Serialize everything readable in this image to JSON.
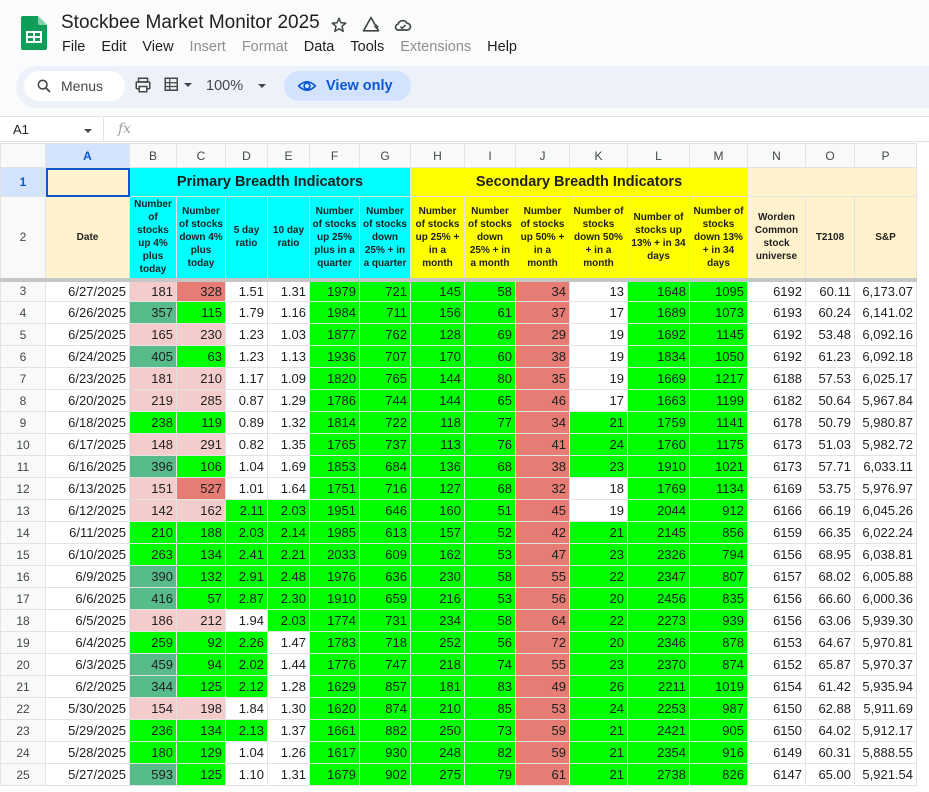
{
  "app": {
    "title": "Stockbee Market Monitor 2025",
    "menu": [
      {
        "label": "File",
        "enabled": true
      },
      {
        "label": "Edit",
        "enabled": true
      },
      {
        "label": "View",
        "enabled": true
      },
      {
        "label": "Insert",
        "enabled": false
      },
      {
        "label": "Format",
        "enabled": false
      },
      {
        "label": "Data",
        "enabled": true
      },
      {
        "label": "Tools",
        "enabled": true
      },
      {
        "label": "Extensions",
        "enabled": false
      },
      {
        "label": "Help",
        "enabled": true
      }
    ]
  },
  "toolbar": {
    "search_label": "Menus",
    "zoom": "100%",
    "view_only_label": "View only"
  },
  "formula_bar": {
    "cell_ref": "A1",
    "fx_label": "fx",
    "value": ""
  },
  "colors": {
    "cyan": "#00ffff",
    "yellow": "#ffff00",
    "cream": "#fff2cc",
    "green": "#00ff00",
    "dark_green": "#57bb8a",
    "red": "#e67c73",
    "pink": "#f4cccc",
    "white": "#ffffff"
  },
  "sheet": {
    "columns": [
      "A",
      "B",
      "C",
      "D",
      "E",
      "F",
      "G",
      "H",
      "I",
      "J",
      "K",
      "L",
      "M",
      "N",
      "O",
      "P"
    ],
    "selected_column": "A",
    "selected_row": "1",
    "group_headers": {
      "primary": "Primary Breadth Indicators",
      "secondary": "Secondary Breadth Indicators"
    },
    "headers": [
      "Date",
      "Number of stocks up 4% plus today",
      "Number of stocks down 4% plus today",
      "5 day ratio",
      "10 day ratio",
      "Number of stocks up 25% plus in a quarter",
      "Number of stocks down 25% + in a quarter",
      "Number of stocks up 25% + in a month",
      "Number of stocks down 25% + in a month",
      "Number of stocks up 50% + in a month",
      "Number of stocks down 50% + in a month",
      "Number of stocks up 13% + in 34 days",
      "Number of stocks down 13% + in 34 days",
      "Worden Common stock universe",
      "T2108",
      "S&P"
    ],
    "rows": [
      {
        "n": "3",
        "cells": [
          "6/27/2025",
          "181",
          "328",
          "1.51",
          "1.31",
          "1979",
          "721",
          "145",
          "58",
          "34",
          "13",
          "1648",
          "1095",
          "6192",
          "60.11",
          "6,173.07"
        ],
        "fills": [
          "",
          "pink",
          "red",
          "",
          "",
          "green",
          "green",
          "green",
          "green",
          "red",
          "white",
          "green",
          "green",
          "",
          "",
          ""
        ]
      },
      {
        "n": "4",
        "cells": [
          "6/26/2025",
          "357",
          "115",
          "1.79",
          "1.16",
          "1984",
          "711",
          "156",
          "61",
          "37",
          "17",
          "1689",
          "1073",
          "6193",
          "60.24",
          "6,141.02"
        ],
        "fills": [
          "",
          "dgreen",
          "green",
          "",
          "",
          "green",
          "green",
          "green",
          "green",
          "red",
          "white",
          "green",
          "green",
          "",
          "",
          ""
        ]
      },
      {
        "n": "5",
        "cells": [
          "6/25/2025",
          "165",
          "230",
          "1.23",
          "1.03",
          "1877",
          "762",
          "128",
          "69",
          "29",
          "19",
          "1692",
          "1145",
          "6192",
          "53.48",
          "6,092.16"
        ],
        "fills": [
          "",
          "pink",
          "pink",
          "",
          "",
          "green",
          "green",
          "green",
          "green",
          "red",
          "white",
          "green",
          "green",
          "",
          "",
          ""
        ]
      },
      {
        "n": "6",
        "cells": [
          "6/24/2025",
          "405",
          "63",
          "1.23",
          "1.13",
          "1936",
          "707",
          "170",
          "60",
          "38",
          "19",
          "1834",
          "1050",
          "6192",
          "61.23",
          "6,092.18"
        ],
        "fills": [
          "",
          "dgreen",
          "green",
          "",
          "",
          "green",
          "green",
          "green",
          "green",
          "red",
          "white",
          "green",
          "green",
          "",
          "",
          ""
        ]
      },
      {
        "n": "7",
        "cells": [
          "6/23/2025",
          "181",
          "210",
          "1.17",
          "1.09",
          "1820",
          "765",
          "144",
          "80",
          "35",
          "19",
          "1669",
          "1217",
          "6188",
          "57.53",
          "6,025.17"
        ],
        "fills": [
          "",
          "pink",
          "pink",
          "",
          "",
          "green",
          "green",
          "green",
          "green",
          "red",
          "white",
          "green",
          "green",
          "",
          "",
          ""
        ]
      },
      {
        "n": "8",
        "cells": [
          "6/20/2025",
          "219",
          "285",
          "0.87",
          "1.29",
          "1786",
          "744",
          "144",
          "65",
          "46",
          "17",
          "1663",
          "1199",
          "6182",
          "50.64",
          "5,967.84"
        ],
        "fills": [
          "",
          "pink",
          "pink",
          "",
          "",
          "green",
          "green",
          "green",
          "green",
          "red",
          "white",
          "green",
          "green",
          "",
          "",
          ""
        ]
      },
      {
        "n": "9",
        "cells": [
          "6/18/2025",
          "238",
          "119",
          "0.89",
          "1.32",
          "1814",
          "722",
          "118",
          "77",
          "34",
          "21",
          "1759",
          "1141",
          "6178",
          "50.79",
          "5,980.87"
        ],
        "fills": [
          "",
          "green",
          "green",
          "",
          "",
          "green",
          "green",
          "green",
          "green",
          "red",
          "green",
          "green",
          "green",
          "",
          "",
          ""
        ]
      },
      {
        "n": "10",
        "cells": [
          "6/17/2025",
          "148",
          "291",
          "0.82",
          "1.35",
          "1765",
          "737",
          "113",
          "76",
          "41",
          "24",
          "1760",
          "1175",
          "6173",
          "51.03",
          "5,982.72"
        ],
        "fills": [
          "",
          "pink",
          "pink",
          "",
          "",
          "green",
          "green",
          "green",
          "green",
          "red",
          "green",
          "green",
          "green",
          "",
          "",
          ""
        ]
      },
      {
        "n": "11",
        "cells": [
          "6/16/2025",
          "396",
          "106",
          "1.04",
          "1.69",
          "1853",
          "684",
          "136",
          "68",
          "38",
          "23",
          "1910",
          "1021",
          "6173",
          "57.71",
          "6,033.11"
        ],
        "fills": [
          "",
          "dgreen",
          "green",
          "",
          "",
          "green",
          "green",
          "green",
          "green",
          "red",
          "green",
          "green",
          "green",
          "",
          "",
          ""
        ]
      },
      {
        "n": "12",
        "cells": [
          "6/13/2025",
          "151",
          "527",
          "1.01",
          "1.64",
          "1751",
          "716",
          "127",
          "68",
          "32",
          "18",
          "1769",
          "1134",
          "6169",
          "53.75",
          "5,976.97"
        ],
        "fills": [
          "",
          "pink",
          "red",
          "",
          "",
          "green",
          "green",
          "green",
          "green",
          "red",
          "white",
          "green",
          "green",
          "",
          "",
          ""
        ]
      },
      {
        "n": "13",
        "cells": [
          "6/12/2025",
          "142",
          "162",
          "2.11",
          "2.03",
          "1951",
          "646",
          "160",
          "51",
          "45",
          "19",
          "2044",
          "912",
          "6166",
          "66.19",
          "6,045.26"
        ],
        "fills": [
          "",
          "pink",
          "pink",
          "green",
          "green",
          "green",
          "green",
          "green",
          "green",
          "red",
          "white",
          "green",
          "green",
          "",
          "",
          ""
        ]
      },
      {
        "n": "14",
        "cells": [
          "6/11/2025",
          "210",
          "188",
          "2.03",
          "2.14",
          "1985",
          "613",
          "157",
          "52",
          "42",
          "21",
          "2145",
          "856",
          "6159",
          "66.35",
          "6,022.24"
        ],
        "fills": [
          "",
          "green",
          "green",
          "green",
          "green",
          "green",
          "green",
          "green",
          "green",
          "red",
          "green",
          "green",
          "green",
          "",
          "",
          ""
        ]
      },
      {
        "n": "15",
        "cells": [
          "6/10/2025",
          "263",
          "134",
          "2.41",
          "2.21",
          "2033",
          "609",
          "162",
          "53",
          "47",
          "23",
          "2326",
          "794",
          "6156",
          "68.95",
          "6,038.81"
        ],
        "fills": [
          "",
          "green",
          "green",
          "green",
          "green",
          "green",
          "green",
          "green",
          "green",
          "red",
          "green",
          "green",
          "green",
          "",
          "",
          ""
        ]
      },
      {
        "n": "16",
        "cells": [
          "6/9/2025",
          "390",
          "132",
          "2.91",
          "2.48",
          "1976",
          "636",
          "230",
          "58",
          "55",
          "22",
          "2347",
          "807",
          "6157",
          "68.02",
          "6,005.88"
        ],
        "fills": [
          "",
          "dgreen",
          "green",
          "green",
          "green",
          "green",
          "green",
          "green",
          "green",
          "red",
          "green",
          "green",
          "green",
          "",
          "",
          ""
        ]
      },
      {
        "n": "17",
        "cells": [
          "6/6/2025",
          "416",
          "57",
          "2.87",
          "2.30",
          "1910",
          "659",
          "216",
          "53",
          "56",
          "20",
          "2456",
          "835",
          "6156",
          "66.60",
          "6,000.36"
        ],
        "fills": [
          "",
          "dgreen",
          "green",
          "green",
          "green",
          "green",
          "green",
          "green",
          "green",
          "red",
          "green",
          "green",
          "green",
          "",
          "",
          ""
        ]
      },
      {
        "n": "18",
        "cells": [
          "6/5/2025",
          "186",
          "212",
          "1.94",
          "2.03",
          "1774",
          "731",
          "234",
          "58",
          "64",
          "22",
          "2273",
          "939",
          "6156",
          "63.06",
          "5,939.30"
        ],
        "fills": [
          "",
          "pink",
          "pink",
          "",
          "green",
          "green",
          "green",
          "green",
          "green",
          "red",
          "green",
          "green",
          "green",
          "",
          "",
          ""
        ]
      },
      {
        "n": "19",
        "cells": [
          "6/4/2025",
          "259",
          "92",
          "2.26",
          "1.47",
          "1783",
          "718",
          "252",
          "56",
          "72",
          "20",
          "2346",
          "878",
          "6153",
          "64.67",
          "5,970.81"
        ],
        "fills": [
          "",
          "green",
          "green",
          "green",
          "",
          "green",
          "green",
          "green",
          "green",
          "red",
          "green",
          "green",
          "green",
          "",
          "",
          ""
        ]
      },
      {
        "n": "20",
        "cells": [
          "6/3/2025",
          "459",
          "94",
          "2.02",
          "1.44",
          "1776",
          "747",
          "218",
          "74",
          "55",
          "23",
          "2370",
          "874",
          "6152",
          "65.87",
          "5,970.37"
        ],
        "fills": [
          "",
          "dgreen",
          "green",
          "green",
          "",
          "green",
          "green",
          "green",
          "green",
          "red",
          "green",
          "green",
          "green",
          "",
          "",
          ""
        ]
      },
      {
        "n": "21",
        "cells": [
          "6/2/2025",
          "344",
          "125",
          "2.12",
          "1.28",
          "1629",
          "857",
          "181",
          "83",
          "49",
          "26",
          "2211",
          "1019",
          "6154",
          "61.42",
          "5,935.94"
        ],
        "fills": [
          "",
          "dgreen",
          "green",
          "green",
          "",
          "green",
          "green",
          "green",
          "green",
          "red",
          "green",
          "green",
          "green",
          "",
          "",
          ""
        ]
      },
      {
        "n": "22",
        "cells": [
          "5/30/2025",
          "154",
          "198",
          "1.84",
          "1.30",
          "1620",
          "874",
          "210",
          "85",
          "53",
          "24",
          "2253",
          "987",
          "6150",
          "62.88",
          "5,911.69"
        ],
        "fills": [
          "",
          "pink",
          "pink",
          "",
          "",
          "green",
          "green",
          "green",
          "green",
          "red",
          "green",
          "green",
          "green",
          "",
          "",
          ""
        ]
      },
      {
        "n": "23",
        "cells": [
          "5/29/2025",
          "236",
          "134",
          "2.13",
          "1.37",
          "1661",
          "882",
          "250",
          "73",
          "59",
          "21",
          "2421",
          "905",
          "6150",
          "64.02",
          "5,912.17"
        ],
        "fills": [
          "",
          "green",
          "green",
          "green",
          "",
          "green",
          "green",
          "green",
          "green",
          "red",
          "green",
          "green",
          "green",
          "",
          "",
          ""
        ]
      },
      {
        "n": "24",
        "cells": [
          "5/28/2025",
          "180",
          "129",
          "1.04",
          "1.26",
          "1617",
          "930",
          "248",
          "82",
          "59",
          "21",
          "2354",
          "916",
          "6149",
          "60.31",
          "5,888.55"
        ],
        "fills": [
          "",
          "green",
          "green",
          "",
          "",
          "green",
          "green",
          "green",
          "green",
          "red",
          "green",
          "green",
          "green",
          "",
          "",
          ""
        ]
      },
      {
        "n": "25",
        "cells": [
          "5/27/2025",
          "593",
          "125",
          "1.10",
          "1.31",
          "1679",
          "902",
          "275",
          "79",
          "61",
          "21",
          "2738",
          "826",
          "6147",
          "65.00",
          "5,921.54"
        ],
        "fills": [
          "",
          "dgreen",
          "green",
          "",
          "",
          "green",
          "green",
          "green",
          "green",
          "red",
          "green",
          "green",
          "green",
          "",
          "",
          ""
        ]
      }
    ]
  }
}
